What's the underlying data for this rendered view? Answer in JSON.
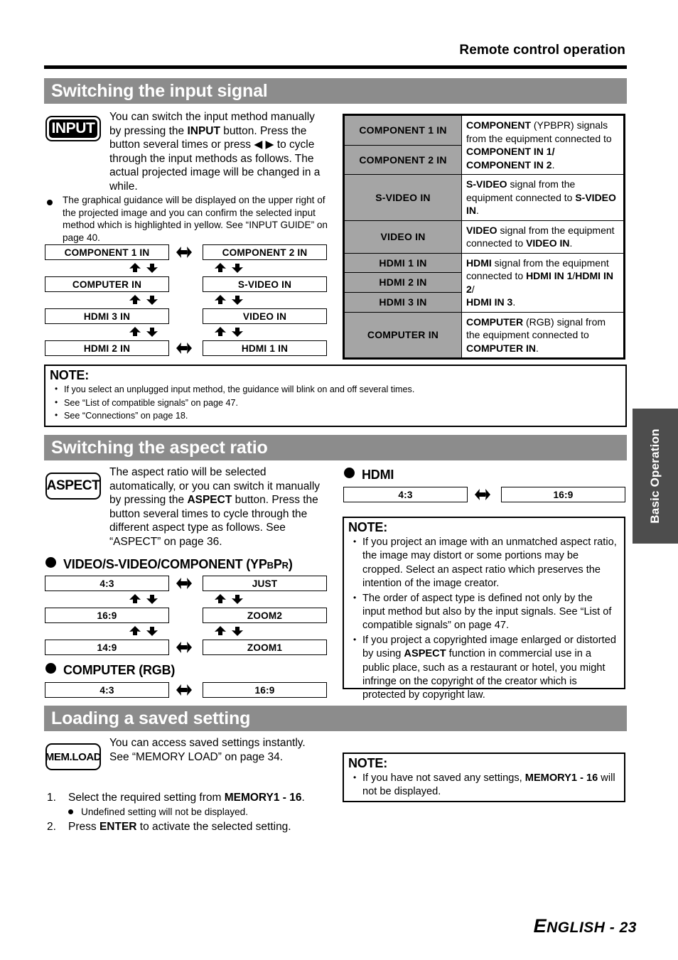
{
  "running_head": "Remote control operation",
  "footer": {
    "lang": "E",
    "lang_rest": "NGLISH",
    "page": " - 23"
  },
  "side_tab": {
    "label": "Basic Operation"
  },
  "sections": {
    "input": {
      "title": "Switching the input signal",
      "key_label": "INPUT",
      "paragraph_1": "You can switch the input method manually by pressing the ",
      "paragraph_1_b1": "INPUT",
      "paragraph_1_c": " button. Press the button several times or press ",
      "paragraph_1_arrows": "◀ ▶",
      "paragraph_1_d": " to cycle through the input methods as follows. The actual projected image will be changed in a while.",
      "bullet_1": "The graphical guidance will be displayed on the upper right of the projected image and you can confirm the selected input method which is highlighted in yellow. See “INPUT GUIDE” on page 40.",
      "flow_left": [
        "COMPONENT 1 IN",
        "COMPUTER IN",
        "HDMI 3 IN",
        "HDMI 2 IN"
      ],
      "flow_right": [
        "COMPONENT 2 IN",
        "S-VIDEO IN",
        "VIDEO IN",
        "HDMI 1 IN"
      ],
      "table_rows": [
        {
          "labels": [
            "COMPONENT 1 IN",
            "COMPONENT 2 IN"
          ],
          "desc_html": "<b>COMPONENT</b> (YPBPR) signals from the equipment connected to <b>COMPONENT IN 1/</b><br><b>COMPONENT IN 2</b>."
        },
        {
          "labels": [
            "S-VIDEO IN"
          ],
          "desc_html": "<b>S-VIDEO</b> signal from the equipment connected to <b>S-VIDEO IN</b>."
        },
        {
          "labels": [
            "VIDEO IN"
          ],
          "desc_html": "<b>VIDEO</b> signal from the equipment connected to <b>VIDEO IN</b>."
        },
        {
          "labels": [
            "HDMI 1 IN",
            "HDMI 2 IN",
            "HDMI 3 IN"
          ],
          "desc_html": "<b>HDMI</b> signal from the equipment connected to <b>HDMI IN 1</b>/<b>HDMI IN 2</b>/<br><b>HDMI IN 3</b>."
        },
        {
          "labels": [
            "COMPUTER IN"
          ],
          "desc_html": "<b>COMPUTER</b> (RGB) signal from the equipment connected to <br><b>COMPUTER IN</b>."
        }
      ],
      "note": {
        "title": "NOTE:",
        "items_html": [
          "If you select an unplugged input method, the guidance will blink on and off several times.",
          "See “List of compatible signals” on page 47.",
          "See “Connections” on page 18."
        ]
      }
    },
    "aspect": {
      "title": "Switching the aspect ratio",
      "key_label": "ASPECT",
      "paragraph_1": "The aspect ratio will be selected automatically, or you can switch it manually by pressing the ",
      "paragraph_1_b1": "ASPECT",
      "paragraph_1_c": " button. Press the button several times to cycle through the different aspect type as follows. See “ASPECT” on page 36.",
      "subhead_video": "VIDEO/S-VIDEO/COMPONENT (YP",
      "subhead_video_sub1": "B",
      "subhead_video_mid": "P",
      "subhead_video_sub2": "R",
      "subhead_video_end": ")",
      "video_flow_left": [
        "4:3",
        "16:9",
        "14:9"
      ],
      "video_flow_right": [
        "JUST",
        "ZOOM2",
        "ZOOM1"
      ],
      "subhead_computer": "COMPUTER (RGB)",
      "computer_flow": [
        "4:3",
        "16:9"
      ],
      "subhead_hdmi": "HDMI",
      "hdmi_flow": [
        "4:3",
        "16:9"
      ],
      "note": {
        "title": "NOTE:",
        "items_html": [
          "If you project an image with an unmatched aspect ratio, the image may distort or some portions may be cropped. Select an aspect ratio which preserves the intention of the image creator.",
          "The order of aspect type is defined not only by the input method but also by the input signals. See “List of compatible signals” on page 47.",
          "If you project a copyrighted image enlarged or distorted by using <b>ASPECT</b> function in commercial use in a public place, such as a restaurant or hotel, you might infringe on the copyright of the creator which is protected by copyright law."
        ]
      }
    },
    "memory": {
      "title": "Loading a saved setting",
      "key_label": "MEM.LOAD",
      "paragraph_1": "You can access saved settings instantly. See “MEMORY LOAD” on page 34.",
      "steps": [
        {
          "num": "1.",
          "text_html": "Select the required setting from <b>MEMORY1 - 16</b>."
        },
        {
          "num": "2.",
          "text_html": "Press <b>ENTER</b> to activate the selected setting."
        }
      ],
      "step_sub": "Undefined setting will not be displayed.",
      "note": {
        "title": "NOTE:",
        "items_html": [
          "If you have not saved any settings, <b>MEMORY1 - 16</b> will not be displayed."
        ]
      }
    }
  },
  "colors": {
    "section_bar": "#8c8c8c",
    "table_label_bg": "#a5a5a5",
    "side_tab_bg": "#4d4d4d"
  }
}
